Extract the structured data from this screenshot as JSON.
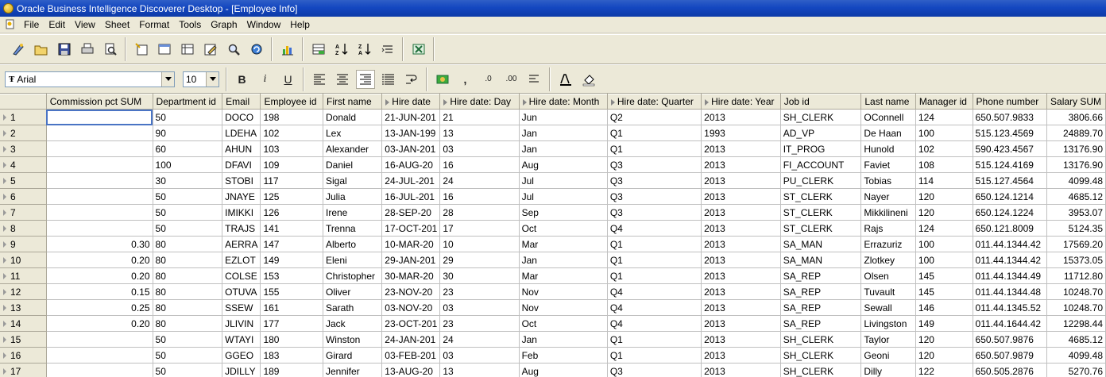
{
  "window": {
    "title": "Oracle Business Intelligence Discoverer Desktop - [Employee Info]"
  },
  "menu": [
    "File",
    "Edit",
    "View",
    "Sheet",
    "Format",
    "Tools",
    "Graph",
    "Window",
    "Help"
  ],
  "format_bar": {
    "font": "Arial",
    "size": "10"
  },
  "toolbar_icons": [
    "new-workbook-icon",
    "open-icon",
    "save-icon",
    "print-icon",
    "print-preview-icon",
    "new-sheet-wizard-icon",
    "layout-icon",
    "table-icon",
    "edit-sheet-icon",
    "find-icon",
    "refresh-icon",
    "graph-icon",
    "totals-icon",
    "sort-ascending-icon",
    "sort-descending-icon",
    "pivot-icon",
    "export-icon"
  ],
  "columns": [
    "Commission pct SUM",
    "Department id",
    "Email",
    "Employee id",
    "First name",
    "Hire date",
    "Hire date: Day",
    "Hire date: Month",
    "Hire date: Quarter",
    "Hire date: Year",
    "Job id",
    "Last name",
    "Manager id",
    "Phone number",
    "Salary SUM"
  ],
  "rows": [
    [
      "1",
      "",
      "50",
      "DOCO",
      "198",
      "Donald",
      "21-JUN-201",
      "21",
      "Jun",
      "Q2",
      "2013",
      "SH_CLERK",
      "OConnell",
      "124",
      "650.507.9833",
      "3806.66"
    ],
    [
      "2",
      "",
      "90",
      "LDEHA",
      "102",
      "Lex",
      "13-JAN-199",
      "13",
      "Jan",
      "Q1",
      "1993",
      "AD_VP",
      "De Haan",
      "100",
      "515.123.4569",
      "24889.70"
    ],
    [
      "3",
      "",
      "60",
      "AHUN",
      "103",
      "Alexander",
      "03-JAN-201",
      "03",
      "Jan",
      "Q1",
      "2013",
      "IT_PROG",
      "Hunold",
      "102",
      "590.423.4567",
      "13176.90"
    ],
    [
      "4",
      "",
      "100",
      "DFAVI",
      "109",
      "Daniel",
      "16-AUG-20",
      "16",
      "Aug",
      "Q3",
      "2013",
      "FI_ACCOUNT",
      "Faviet",
      "108",
      "515.124.4169",
      "13176.90"
    ],
    [
      "5",
      "",
      "30",
      "STOBI",
      "117",
      "Sigal",
      "24-JUL-201",
      "24",
      "Jul",
      "Q3",
      "2013",
      "PU_CLERK",
      "Tobias",
      "114",
      "515.127.4564",
      "4099.48"
    ],
    [
      "6",
      "",
      "50",
      "JNAYE",
      "125",
      "Julia",
      "16-JUL-201",
      "16",
      "Jul",
      "Q3",
      "2013",
      "ST_CLERK",
      "Nayer",
      "120",
      "650.124.1214",
      "4685.12"
    ],
    [
      "7",
      "",
      "50",
      "IMIKKI",
      "126",
      "Irene",
      "28-SEP-20",
      "28",
      "Sep",
      "Q3",
      "2013",
      "ST_CLERK",
      "Mikkilineni",
      "120",
      "650.124.1224",
      "3953.07"
    ],
    [
      "8",
      "",
      "50",
      "TRAJS",
      "141",
      "Trenna",
      "17-OCT-201",
      "17",
      "Oct",
      "Q4",
      "2013",
      "ST_CLERK",
      "Rajs",
      "124",
      "650.121.8009",
      "5124.35"
    ],
    [
      "9",
      "0.30",
      "80",
      "AERRA",
      "147",
      "Alberto",
      "10-MAR-20",
      "10",
      "Mar",
      "Q1",
      "2013",
      "SA_MAN",
      "Errazuriz",
      "100",
      "011.44.1344.42",
      "17569.20"
    ],
    [
      "10",
      "0.20",
      "80",
      "EZLOT",
      "149",
      "Eleni",
      "29-JAN-201",
      "29",
      "Jan",
      "Q1",
      "2013",
      "SA_MAN",
      "Zlotkey",
      "100",
      "011.44.1344.42",
      "15373.05"
    ],
    [
      "11",
      "0.20",
      "80",
      "COLSE",
      "153",
      "Christopher",
      "30-MAR-20",
      "30",
      "Mar",
      "Q1",
      "2013",
      "SA_REP",
      "Olsen",
      "145",
      "011.44.1344.49",
      "11712.80"
    ],
    [
      "12",
      "0.15",
      "80",
      "OTUVA",
      "155",
      "Oliver",
      "23-NOV-20",
      "23",
      "Nov",
      "Q4",
      "2013",
      "SA_REP",
      "Tuvault",
      "145",
      "011.44.1344.48",
      "10248.70"
    ],
    [
      "13",
      "0.25",
      "80",
      "SSEW",
      "161",
      "Sarath",
      "03-NOV-20",
      "03",
      "Nov",
      "Q4",
      "2013",
      "SA_REP",
      "Sewall",
      "146",
      "011.44.1345.52",
      "10248.70"
    ],
    [
      "14",
      "0.20",
      "80",
      "JLIVIN",
      "177",
      "Jack",
      "23-OCT-201",
      "23",
      "Oct",
      "Q4",
      "2013",
      "SA_REP",
      "Livingston",
      "149",
      "011.44.1644.42",
      "12298.44"
    ],
    [
      "15",
      "",
      "50",
      "WTAYI",
      "180",
      "Winston",
      "24-JAN-201",
      "24",
      "Jan",
      "Q1",
      "2013",
      "SH_CLERK",
      "Taylor",
      "120",
      "650.507.9876",
      "4685.12"
    ],
    [
      "16",
      "",
      "50",
      "GGEO",
      "183",
      "Girard",
      "03-FEB-201",
      "03",
      "Feb",
      "Q1",
      "2013",
      "SH_CLERK",
      "Geoni",
      "120",
      "650.507.9879",
      "4099.48"
    ],
    [
      "17",
      "",
      "50",
      "JDILLY",
      "189",
      "Jennifer",
      "13-AUG-20",
      "13",
      "Aug",
      "Q3",
      "2013",
      "SH_CLERK",
      "Dilly",
      "122",
      "650.505.2876",
      "5270.76"
    ]
  ]
}
